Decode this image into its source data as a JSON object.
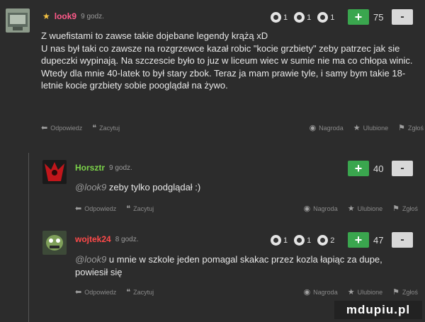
{
  "comments": [
    {
      "username": "look9",
      "time": "9 godz.",
      "badges": [
        "1",
        "1",
        "1"
      ],
      "score": "75",
      "text": "Z wuefistami to zawse takie dojebane legendy krążą xD\nU nas był taki co zawsze na rozgrzewce kazał robic \"kocie grzbiety\" zeby patrzec jak sie dupeczki wypinają. Na szczescie było to juz w liceum wiec w sumie nie ma co chłopa winic. Wtedy dla mnie 40-latek to był stary zbok. Teraz ja mam prawie tyle, i samy bym takie 18-letnie kocie grzbiety sobie pooglądał na żywo."
    },
    {
      "username": "Horsztr",
      "time": "9 godz.",
      "score": "40",
      "mention": "@look9",
      "text": " zeby tylko podglądał :)"
    },
    {
      "username": "wojtek24",
      "time": "8 godz.",
      "badges": [
        "1",
        "1",
        "2"
      ],
      "score": "47",
      "mention": "@look9",
      "text": " u mnie w szkole jeden pomagal skakac przez kozla łapiąc za dupe, powiesił się"
    }
  ],
  "actions": {
    "reply": "Odpowiedz",
    "quote": "Zacytuj",
    "reward": "Nagroda",
    "favorite": "Ulubione",
    "report": "Zgłoś"
  },
  "vote": {
    "plus": "+",
    "minus": "-"
  },
  "watermark": "mdupiu.pl"
}
